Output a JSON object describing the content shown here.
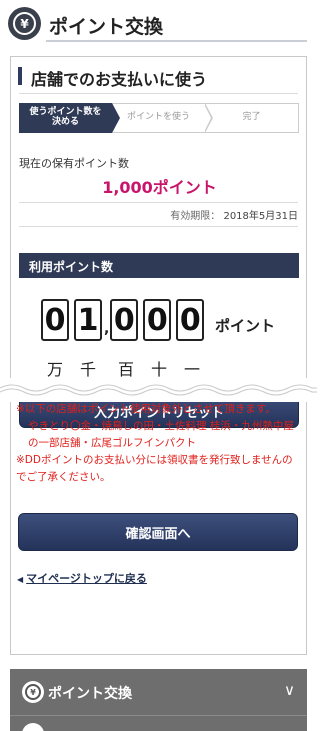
{
  "header": {
    "title": "ポイント交換",
    "logo_glyph": "¥"
  },
  "section": {
    "title": "店舗でのお支払いに使う"
  },
  "steps": [
    {
      "label_line1": "使うポイント数を",
      "label_line2": "決める",
      "active": true
    },
    {
      "label_line1": "ポイントを使う",
      "label_line2": "",
      "active": false
    },
    {
      "label_line1": "完了",
      "label_line2": "",
      "active": false
    }
  ],
  "held_points": {
    "label": "現在の保有ポイント数",
    "value": "1,000ポイント"
  },
  "expiry": {
    "label": "有効期限：",
    "date": "2018年5月31日"
  },
  "use_points": {
    "bar_label": "利用ポイント数",
    "digits": [
      "0",
      "1",
      "0",
      "0",
      "0"
    ],
    "separator": ",",
    "unit": "ポイント",
    "place_labels": [
      "万",
      "千",
      "百",
      "十",
      "一"
    ]
  },
  "reset_button": "入力ポイントリセット",
  "notes": {
    "line1": "※以下の店舗はポイント使用対象外とさせて頂きます。",
    "line2": "やきとり〇金・焼鳥しの田・土佐料理 桂浜・九州熱中屋の一部店舗・広尾ゴルフインパクト",
    "line3": "※DDポイントのお支払い分には領収書を発行致しませんのでご了承ください。"
  },
  "confirm_button": "確認画面へ",
  "mypage_link": {
    "arrow": "◀",
    "label": "マイページトップに戻る"
  },
  "accordion": {
    "label": "ポイント交換",
    "chevron": "∨",
    "logo_glyph": "¥"
  },
  "colors": {
    "navy": "#2f3a56",
    "pink": "#c8156a",
    "red": "#e0201c",
    "accordion_grey": "#6e6e6e"
  }
}
